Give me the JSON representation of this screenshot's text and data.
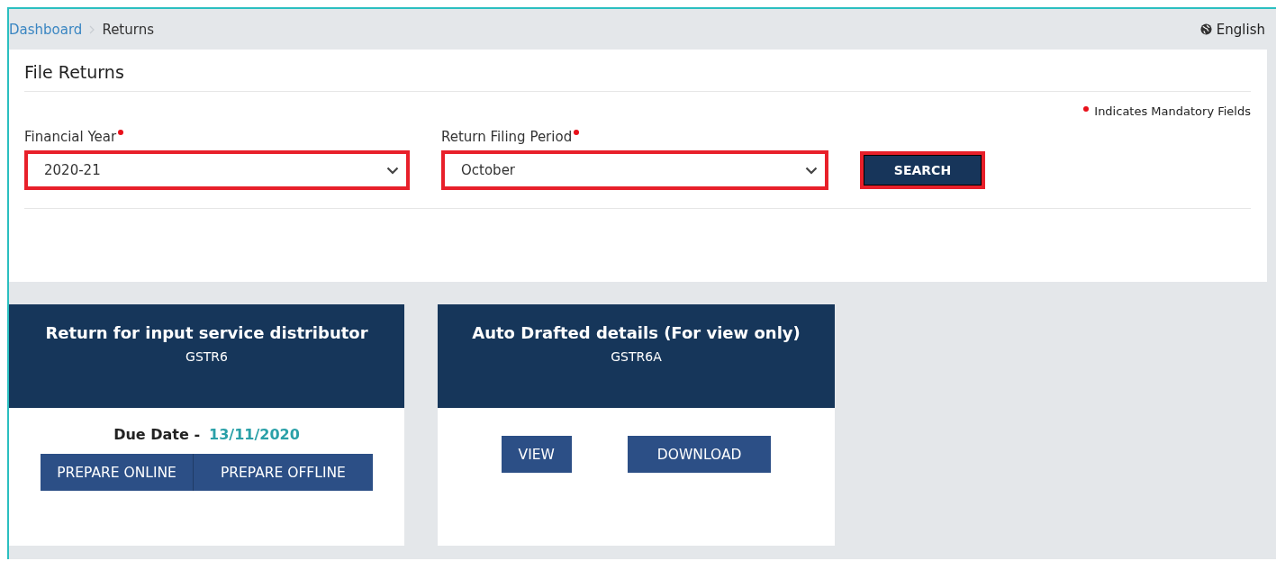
{
  "breadcrumb": [
    {
      "label": "Dashboard",
      "kind": "link"
    },
    {
      "label": "Returns",
      "kind": "current"
    }
  ],
  "language": "English",
  "panel": {
    "title": "File Returns",
    "mandatory_note": "Indicates Mandatory Fields",
    "fields": [
      {
        "label": "Financial Year",
        "value": "2020-21",
        "required": true,
        "highlighted": true
      },
      {
        "label": "Return Filing Period",
        "value": "October",
        "required": true,
        "highlighted": true
      }
    ],
    "search_button": {
      "label": "SEARCH",
      "highlighted": true
    }
  },
  "cards": [
    {
      "title": "Return for input service distributor",
      "subtitle": "GSTR6",
      "due_label": "Due Date -",
      "due_date": "13/11/2020",
      "buttons": [
        "PREPARE ONLINE",
        "PREPARE OFFLINE"
      ],
      "kind": "joined"
    },
    {
      "title": "Auto Drafted details (For view only)",
      "subtitle": "GSTR6A",
      "buttons": [
        "VIEW",
        "DOWNLOAD"
      ],
      "kind": "separate"
    }
  ]
}
